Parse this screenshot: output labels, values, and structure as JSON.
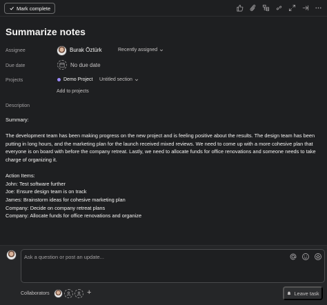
{
  "header": {
    "mark_complete_label": "Mark complete",
    "toolbar_icons": [
      "thumbs-up-icon",
      "attachment-icon",
      "subtasks-icon",
      "link-icon",
      "expand-icon",
      "arrow-right-icon",
      "more-icon"
    ]
  },
  "task": {
    "title": "Summarize notes",
    "fields": {
      "assignee_label": "Assignee",
      "assignee_name": "Burak Öztürk",
      "recently_assigned": "Recently assigned",
      "due_date_label": "Due date",
      "due_date_value": "No due date",
      "projects_label": "Projects",
      "project_name": "Demo Project",
      "project_section": "Untitled section",
      "add_to_projects": "Add to projects",
      "description_label": "Description"
    },
    "description": "Summary:\n\nThe development team has been making progress on the new project and is feeling positive about the results. The design team has been putting in long hours, and the marketing plan for the launch received mixed reviews. We need to come up with a more cohesive plan that everyone is on board with before the company retreat. Lastly, we need to allocate funds for office renovations and someone needs to take charge of organizing it.\n\nAction Items:\nJohn: Test software further\nJoe: Ensure design team is on track\nJames: Brainstorm ideas for cohesive marketing plan\nCompany: Decide on company retreat plans\nCompany: Allocate funds for office renovations and organize"
  },
  "comment": {
    "placeholder": "Ask a question or post an update...",
    "collaborators_label": "Collaborators",
    "leave_task_label": "Leave task"
  },
  "colors": {
    "background": "#1e1f21",
    "footer_background": "#252628",
    "project_dot": "#9b8afb",
    "muted_text": "#a2a0a2"
  }
}
